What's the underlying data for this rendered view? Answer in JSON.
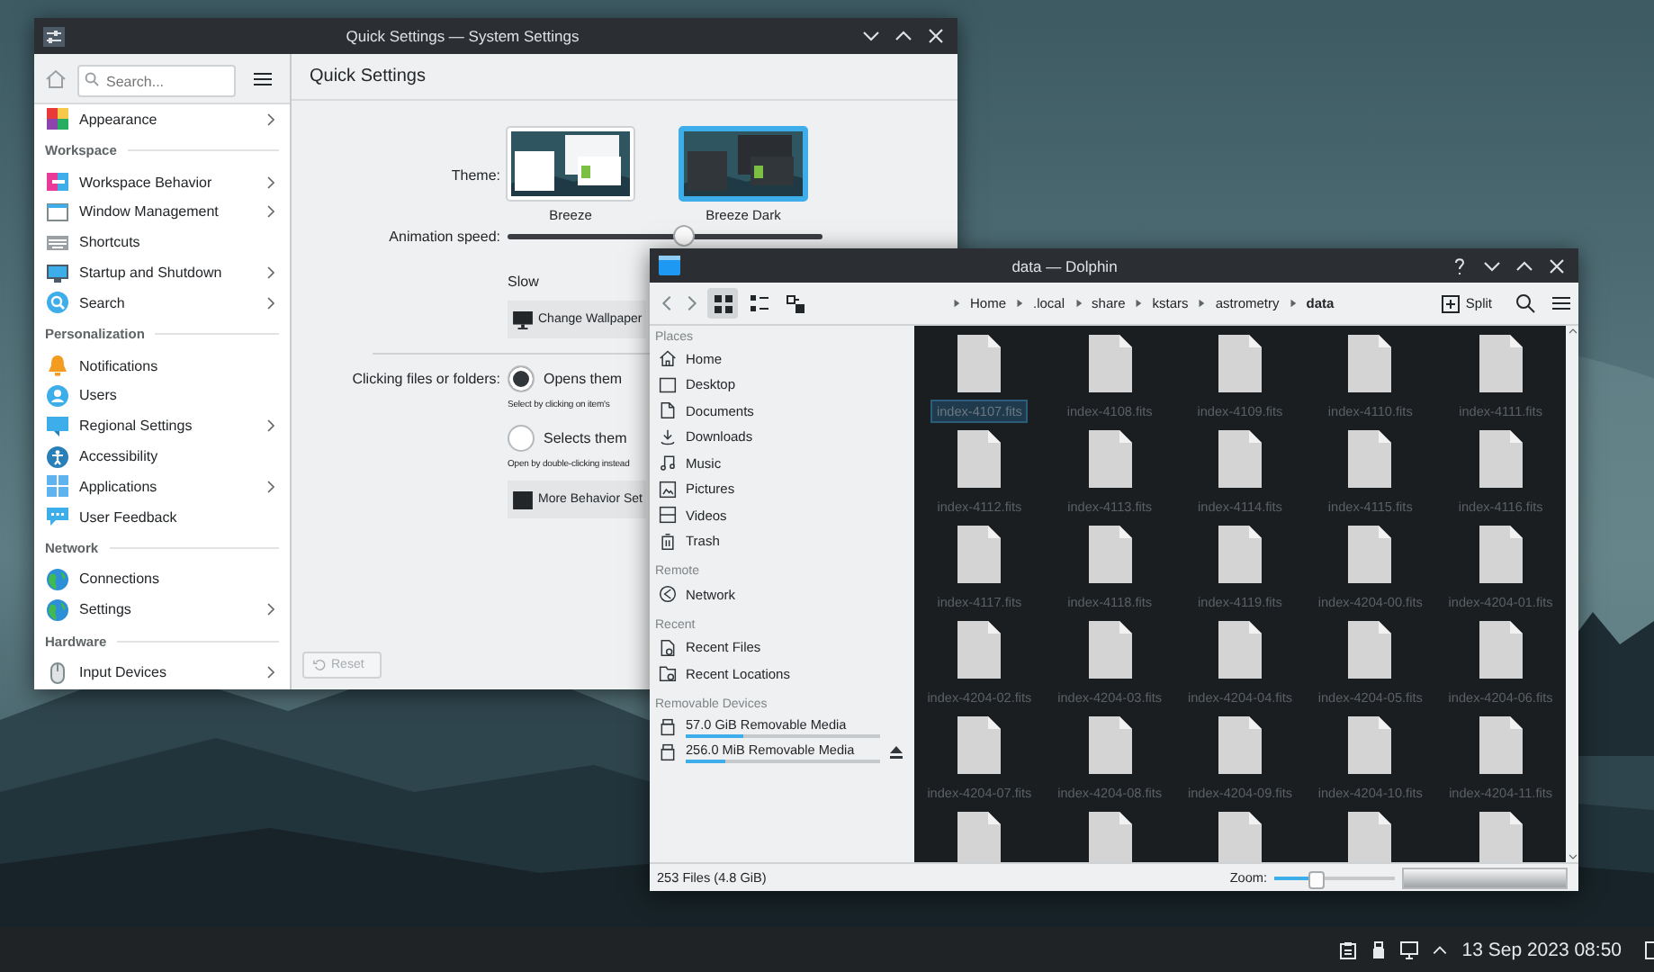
{
  "settings_window": {
    "title": "Quick Settings — System Settings",
    "search": {
      "placeholder": "Search..."
    },
    "sidebar": [
      {
        "items": [
          {
            "label": "Appearance",
            "expandable": true
          }
        ]
      },
      {
        "header": "Workspace",
        "items": [
          {
            "label": "Workspace Behavior",
            "expandable": true
          },
          {
            "label": "Window Management",
            "expandable": true
          },
          {
            "label": "Shortcuts",
            "expandable": false
          },
          {
            "label": "Startup and Shutdown",
            "expandable": true
          },
          {
            "label": "Search",
            "expandable": true
          }
        ]
      },
      {
        "header": "Personalization",
        "items": [
          {
            "label": "Notifications",
            "expandable": false
          },
          {
            "label": "Users",
            "expandable": false
          },
          {
            "label": "Regional Settings",
            "expandable": true
          },
          {
            "label": "Accessibility",
            "expandable": false
          },
          {
            "label": "Applications",
            "expandable": true
          },
          {
            "label": "User Feedback",
            "expandable": false
          }
        ]
      },
      {
        "header": "Network",
        "items": [
          {
            "label": "Connections",
            "expandable": false
          },
          {
            "label": "Settings",
            "expandable": true
          }
        ]
      },
      {
        "header": "Hardware",
        "items": [
          {
            "label": "Input Devices",
            "expandable": true
          }
        ]
      }
    ],
    "page_title": "Quick Settings",
    "theme": {
      "label": "Theme:",
      "options": [
        {
          "name": "Breeze",
          "kind": "light",
          "selected": false
        },
        {
          "name": "Breeze Dark",
          "kind": "dark",
          "selected": true
        }
      ]
    },
    "animation_speed": {
      "label": "Animation speed:",
      "level": 0.56,
      "min_label": "Slow"
    },
    "wallpaper_button": "Change Wallpaper",
    "click_behavior": {
      "label": "Clicking files or folders:",
      "options": [
        {
          "label": "Opens them",
          "hint": "Select by clicking on item's",
          "selected": true
        },
        {
          "label": "Selects them",
          "hint": "Open by double-clicking instead",
          "selected": false
        }
      ]
    },
    "more_button": "More Behavior Set",
    "reset_button": {
      "label": "Reset",
      "disabled": true
    }
  },
  "dolphin_window": {
    "title": "data — Dolphin",
    "view_modes": [
      {
        "kind": "icons",
        "selected": true
      },
      {
        "kind": "compact",
        "selected": false
      },
      {
        "kind": "details",
        "selected": false
      }
    ],
    "breadcrumb": [
      {
        "label": "Home",
        "selected": false
      },
      {
        "label": ".local",
        "selected": false
      },
      {
        "label": "share",
        "selected": false
      },
      {
        "label": "kstars",
        "selected": false
      },
      {
        "label": "astrometry",
        "selected": false
      },
      {
        "label": "data",
        "selected": true
      }
    ],
    "split_button": "Split",
    "places": [
      {
        "header": "Places",
        "items": [
          {
            "label": "Home"
          },
          {
            "label": "Desktop"
          },
          {
            "label": "Documents"
          },
          {
            "label": "Downloads"
          },
          {
            "label": "Music"
          },
          {
            "label": "Pictures"
          },
          {
            "label": "Videos"
          },
          {
            "label": "Trash"
          }
        ]
      },
      {
        "header": "Remote",
        "items": [
          {
            "label": "Network"
          }
        ]
      },
      {
        "header": "Recent",
        "items": [
          {
            "label": "Recent Files"
          },
          {
            "label": "Recent Locations"
          }
        ]
      },
      {
        "header": "Removable Devices",
        "items": [
          {
            "label": "57.0 GiB Removable Media",
            "level": 0.3,
            "ejectable": false
          },
          {
            "label": "256.0 MiB Removable Media",
            "level": 0.2,
            "ejectable": true
          }
        ]
      }
    ],
    "files": [
      {
        "name": "index-4107.fits",
        "selected": true
      },
      {
        "name": "index-4108.fits",
        "selected": false
      },
      {
        "name": "index-4109.fits",
        "selected": false
      },
      {
        "name": "index-4110.fits",
        "selected": false
      },
      {
        "name": "index-4111.fits",
        "selected": false
      },
      {
        "name": "index-4112.fits",
        "selected": false
      },
      {
        "name": "index-4113.fits",
        "selected": false
      },
      {
        "name": "index-4114.fits",
        "selected": false
      },
      {
        "name": "index-4115.fits",
        "selected": false
      },
      {
        "name": "index-4116.fits",
        "selected": false
      },
      {
        "name": "index-4117.fits",
        "selected": false
      },
      {
        "name": "index-4118.fits",
        "selected": false
      },
      {
        "name": "index-4119.fits",
        "selected": false
      },
      {
        "name": "index-4204-00.fits",
        "selected": false
      },
      {
        "name": "index-4204-01.fits",
        "selected": false
      },
      {
        "name": "index-4204-02.fits",
        "selected": false
      },
      {
        "name": "index-4204-03.fits",
        "selected": false
      },
      {
        "name": "index-4204-04.fits",
        "selected": false
      },
      {
        "name": "index-4204-05.fits",
        "selected": false
      },
      {
        "name": "index-4204-06.fits",
        "selected": false
      },
      {
        "name": "index-4204-07.fits",
        "selected": false
      },
      {
        "name": "index-4204-08.fits",
        "selected": false
      },
      {
        "name": "index-4204-09.fits",
        "selected": false
      },
      {
        "name": "index-4204-10.fits",
        "selected": false
      },
      {
        "name": "index-4204-11.fits",
        "selected": false
      }
    ],
    "status": "253 Files (4.8 GiB)",
    "zoom": {
      "label": "Zoom:",
      "level": 0.35
    }
  },
  "taskbar": {
    "clock": "13 Sep 2023 08:50"
  }
}
